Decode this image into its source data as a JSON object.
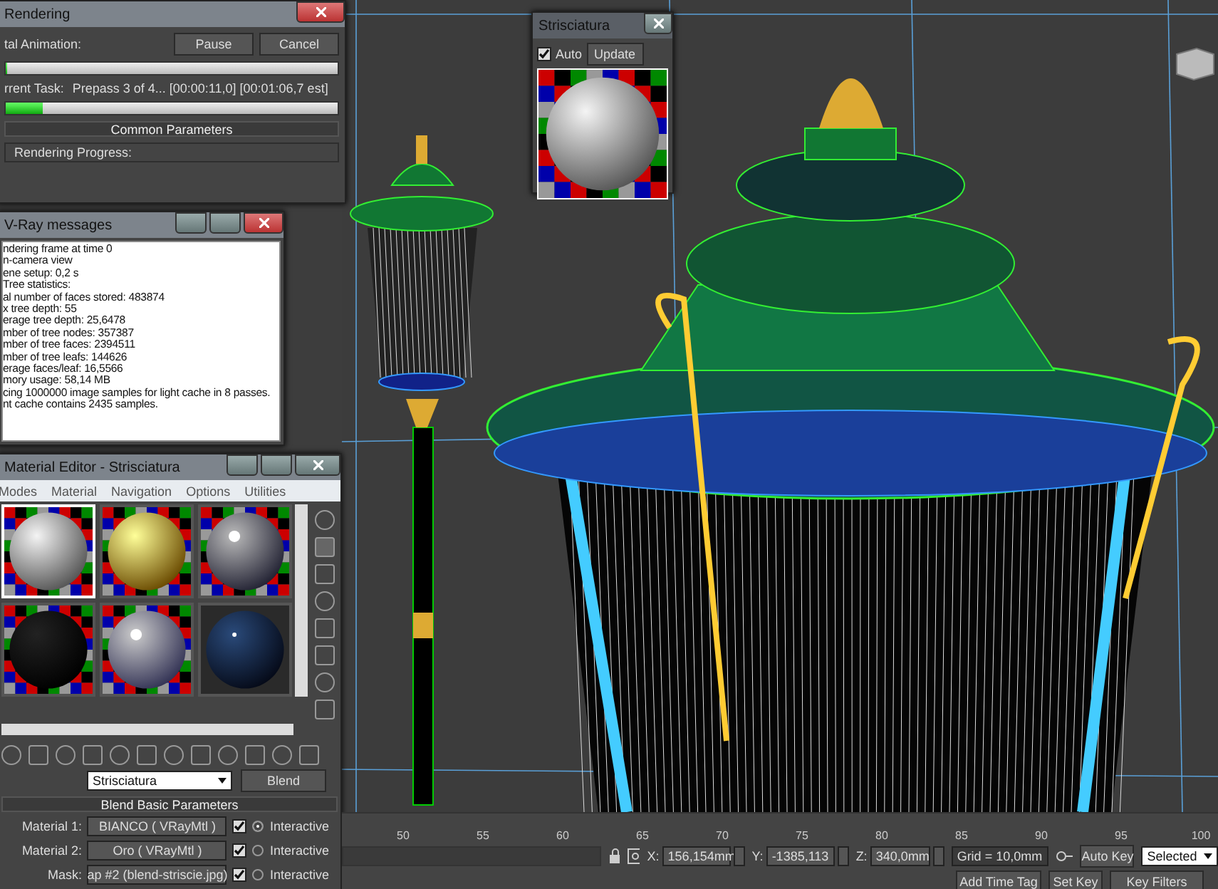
{
  "rendering": {
    "title": "Rendering",
    "buttons": [
      "Pause",
      "Cancel"
    ],
    "total": {
      "label": "tal Animation:",
      "level": 0
    },
    "task": {
      "label": "rrent Task:",
      "value": "Prepass 3 of 4... [00:00:11,0] [00:01:06,7 est]",
      "level": 0.11
    },
    "rollout": "Common Parameters",
    "group": "Rendering Progress:"
  },
  "vray": {
    "title": "V-Ray messages",
    "lines": [
      "ndering frame at time 0",
      "n-camera view",
      "ene setup: 0,2 s",
      "Tree statistics:",
      "al number of faces stored: 483874",
      "x tree depth: 55",
      "erage tree depth: 25,6478",
      "mber of tree nodes: 357387",
      "mber of tree faces: 2394511",
      "mber of tree leafs: 144626",
      "erage faces/leaf: 16,5566",
      "mory usage: 58,14 MB",
      "cing 1000000 image samples for light cache in 8 passes.",
      "nt cache contains 2435 samples."
    ]
  },
  "preview": {
    "title": "Strisciatura",
    "auto_label": "Auto",
    "auto_checked": true,
    "button": "Update"
  },
  "material_editor": {
    "title": "Material Editor - Strisciatura",
    "menu": [
      "Modes",
      "Material",
      "Navigation",
      "Options",
      "Utilities"
    ],
    "slots": [
      {
        "kind": "matte",
        "selected": true
      },
      {
        "kind": "gold",
        "selected": false
      },
      {
        "kind": "chrome",
        "selected": false
      },
      {
        "kind": "black",
        "selected": false
      },
      {
        "kind": "blurry",
        "selected": false
      },
      {
        "kind": "glossy",
        "selected": false
      }
    ],
    "name": "Strisciatura",
    "type": "Blend",
    "rollout": "Blend Basic Parameters",
    "params": [
      {
        "label": "Material 1:",
        "value": "BIANCO  ( VRayMtl )",
        "checked": true,
        "selected": true,
        "option": "Interactive"
      },
      {
        "label": "Material 2:",
        "value": "Oro  ( VRayMtl )",
        "checked": true,
        "selected": false,
        "option": "Interactive"
      },
      {
        "label": "Mask:",
        "value": "ap #2 (blend-striscie.jpg)",
        "checked": true,
        "selected": false,
        "option": "Interactive"
      }
    ]
  },
  "timeline": {
    "ticks": [
      "50",
      "55",
      "60",
      "65",
      "70",
      "75",
      "80",
      "85",
      "90",
      "95",
      "100"
    ],
    "coords": [
      {
        "axis": "X:",
        "value": "156,154mm"
      },
      {
        "axis": "Y:",
        "value": "-1385,113"
      },
      {
        "axis": "Z:",
        "value": "340,0mm"
      }
    ],
    "grid": "Grid = 10,0mm",
    "auto_key": "Auto Key",
    "set_key": "Set Key",
    "key_mode": "Selected",
    "key_filters": "Key Filters",
    "time_tag": "Add Time Tag"
  }
}
